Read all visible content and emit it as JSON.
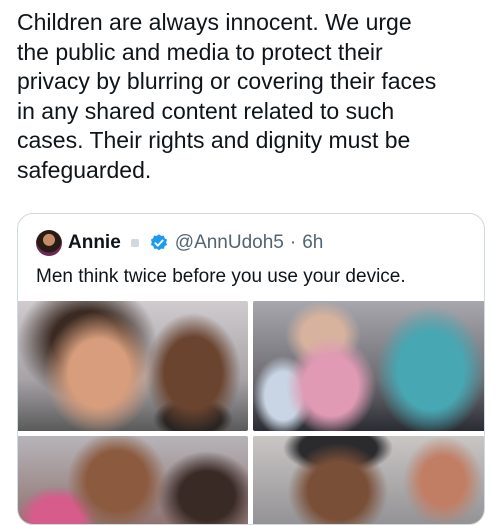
{
  "tweet": {
    "text": "Children are always innocent. We urge\nthe public and media to protect their\nprivacy by blurring or covering their faces\nin any shared content related to such\ncases. Their rights and dignity must be\nsafeguarded."
  },
  "quote": {
    "author_name": "Annie",
    "handle": "@AnnUdoh5",
    "separator": "·",
    "time": "6h",
    "text": "Men think twice before you use your device.",
    "verified_color": "#1d9bf0"
  },
  "media": {
    "count": 4,
    "icons": [
      "avatar",
      "verified-badge-icon"
    ]
  }
}
